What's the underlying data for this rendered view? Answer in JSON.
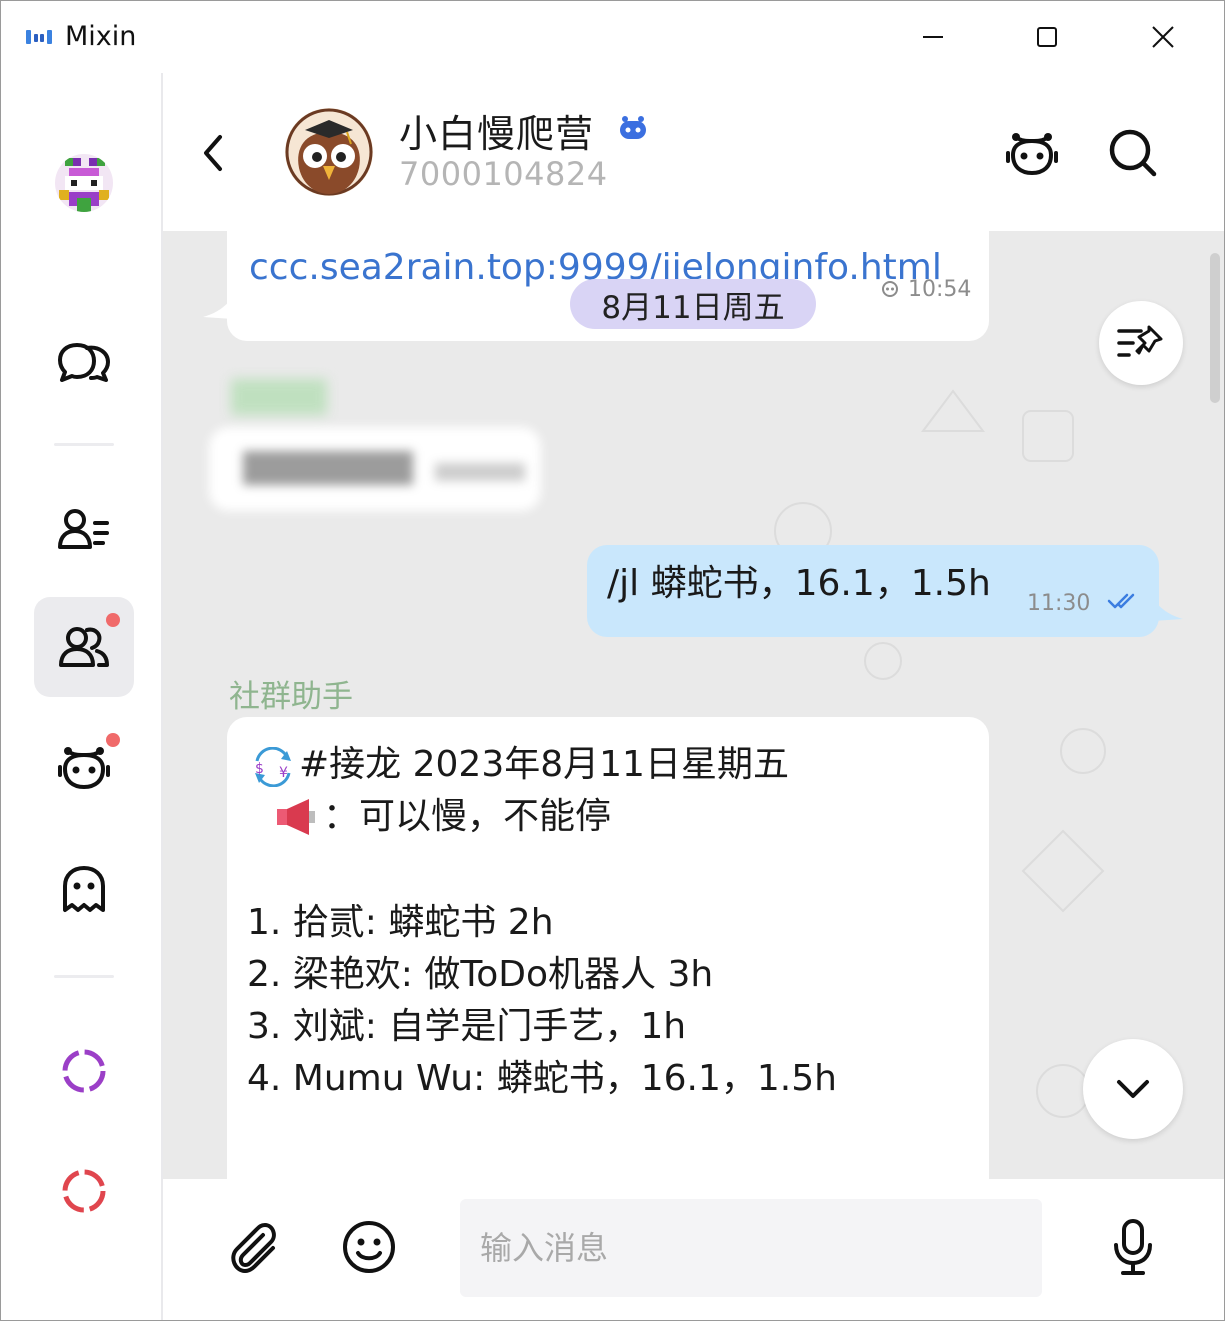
{
  "window": {
    "title": "Mixin",
    "controls": [
      "minimize",
      "maximize",
      "close"
    ]
  },
  "sidebar": {
    "items": [
      {
        "name": "profile-avatar",
        "badge": false
      },
      {
        "name": "chats",
        "icon": "chat-bubbles-icon",
        "badge": false
      },
      {
        "name": "contacts",
        "icon": "contact-list-icon",
        "badge": false
      },
      {
        "name": "groups",
        "icon": "group-icon",
        "badge": true,
        "active": true
      },
      {
        "name": "bots",
        "icon": "bot-icon",
        "badge": true
      },
      {
        "name": "strangers",
        "icon": "ghost-icon",
        "badge": false
      },
      {
        "name": "circle-purple",
        "icon": "circle-icon",
        "color": "#9b3fc7"
      },
      {
        "name": "circle-red",
        "icon": "circle-icon",
        "color": "#e0464e"
      }
    ]
  },
  "header": {
    "title": "小白慢爬营",
    "subtitle": "7000104824",
    "verified_icon": "bot-badge-icon"
  },
  "messages": {
    "link_message": {
      "link": "ccc.sea2rain.top:9999/jielonginfo.html",
      "time": "10:54"
    },
    "date_divider": "8月11日周五",
    "outgoing": {
      "text": "/jl 蟒蛇书，16.1，1.5h",
      "time": "11:30"
    },
    "bot_message": {
      "sender": "社群助手",
      "line1": "#接龙 2023年8月11日星期五",
      "line2": "：可以慢，不能停",
      "items": [
        "1. 拾贰: 蟒蛇书 2h",
        "2. 梁艳欢: 做ToDo机器人 3h",
        "3. 刘斌: 自学是门手艺，1h",
        "4. Mumu Wu: 蟒蛇书，16.1，1.5h"
      ]
    }
  },
  "input": {
    "placeholder": "输入消息"
  },
  "colors": {
    "link": "#3a74cf",
    "outgoing_bubble": "#c9e7fc",
    "date_chip": "#d9d4f5",
    "sender_name": "#8fb58f",
    "badge": "#f06a6a",
    "accent_bot": "#3b6fe0"
  }
}
